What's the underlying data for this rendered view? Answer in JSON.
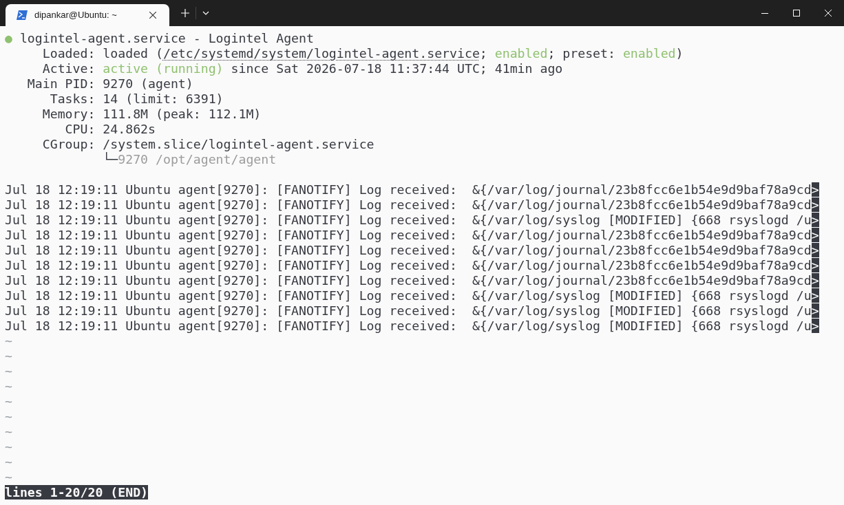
{
  "tabs": [
    {
      "title": "dipankar@Ubuntu: ~",
      "selected": true
    }
  ],
  "terminal": {
    "blocks": [
      {
        "lines": [
          {
            "segments": [
              {
                "text": "●",
                "kind": "green"
              },
              {
                "text": " logintel-agent.service - Logintel Agent",
                "kind": "normal"
              }
            ]
          },
          {
            "segments": [
              {
                "text": "     Loaded: loaded (",
                "kind": "normal"
              },
              {
                "text": "/etc/systemd/system/logintel-agent.service",
                "kind": "link"
              },
              {
                "text": "; ",
                "kind": "normal"
              },
              {
                "text": "enabled",
                "kind": "green"
              },
              {
                "text": "; preset: ",
                "kind": "normal"
              },
              {
                "text": "enabled",
                "kind": "green"
              },
              {
                "text": ")",
                "kind": "normal"
              }
            ]
          },
          {
            "segments": [
              {
                "text": "     Active: ",
                "kind": "normal"
              },
              {
                "text": "active (running)",
                "kind": "green"
              },
              {
                "text": " since Sat 2026-07-18 11:37:44 UTC; 41min ago",
                "kind": "normal"
              }
            ]
          },
          {
            "segments": [
              {
                "text": "   Main PID: 9270 (agent)",
                "kind": "normal"
              }
            ]
          },
          {
            "segments": [
              {
                "text": "      Tasks: 14 (limit: 6391)",
                "kind": "normal"
              }
            ]
          },
          {
            "segments": [
              {
                "text": "     Memory: 111.8M (peak: 112.1M)",
                "kind": "normal"
              }
            ]
          },
          {
            "segments": [
              {
                "text": "        CPU: 24.862s",
                "kind": "normal"
              }
            ]
          },
          {
            "segments": [
              {
                "text": "     CGroup: /system.slice/logintel-agent.service",
                "kind": "normal"
              }
            ]
          },
          {
            "segments": [
              {
                "text": "             └─",
                "kind": "normal"
              },
              {
                "text": "9270 /opt/agent/agent",
                "kind": "dim"
              }
            ]
          }
        ]
      },
      {
        "lines": [
          {
            "segments": [
              {
                "text": "Jul 18 12:19:11 Ubuntu agent[9270]: [FANOTIFY] Log received:  &{/var/log/journal/23b8fcc6e1b54e9d9baf78a9cd",
                "kind": "normal"
              },
              {
                "text": ">",
                "kind": "reverse"
              }
            ]
          },
          {
            "segments": [
              {
                "text": "Jul 18 12:19:11 Ubuntu agent[9270]: [FANOTIFY] Log received:  &{/var/log/journal/23b8fcc6e1b54e9d9baf78a9cd",
                "kind": "normal"
              },
              {
                "text": ">",
                "kind": "reverse"
              }
            ]
          },
          {
            "segments": [
              {
                "text": "Jul 18 12:19:11 Ubuntu agent[9270]: [FANOTIFY] Log received:  &{/var/log/syslog [MODIFIED] {668 rsyslogd /u",
                "kind": "normal"
              },
              {
                "text": ">",
                "kind": "reverse"
              }
            ]
          },
          {
            "segments": [
              {
                "text": "Jul 18 12:19:11 Ubuntu agent[9270]: [FANOTIFY] Log received:  &{/var/log/journal/23b8fcc6e1b54e9d9baf78a9cd",
                "kind": "normal"
              },
              {
                "text": ">",
                "kind": "reverse"
              }
            ]
          },
          {
            "segments": [
              {
                "text": "Jul 18 12:19:11 Ubuntu agent[9270]: [FANOTIFY] Log received:  &{/var/log/journal/23b8fcc6e1b54e9d9baf78a9cd",
                "kind": "normal"
              },
              {
                "text": ">",
                "kind": "reverse"
              }
            ]
          },
          {
            "segments": [
              {
                "text": "Jul 18 12:19:11 Ubuntu agent[9270]: [FANOTIFY] Log received:  &{/var/log/journal/23b8fcc6e1b54e9d9baf78a9cd",
                "kind": "normal"
              },
              {
                "text": ">",
                "kind": "reverse"
              }
            ]
          },
          {
            "segments": [
              {
                "text": "Jul 18 12:19:11 Ubuntu agent[9270]: [FANOTIFY] Log received:  &{/var/log/journal/23b8fcc6e1b54e9d9baf78a9cd",
                "kind": "normal"
              },
              {
                "text": ">",
                "kind": "reverse"
              }
            ]
          },
          {
            "segments": [
              {
                "text": "Jul 18 12:19:11 Ubuntu agent[9270]: [FANOTIFY] Log received:  &{/var/log/syslog [MODIFIED] {668 rsyslogd /u",
                "kind": "normal"
              },
              {
                "text": ">",
                "kind": "reverse"
              }
            ]
          },
          {
            "segments": [
              {
                "text": "Jul 18 12:19:11 Ubuntu agent[9270]: [FANOTIFY] Log received:  &{/var/log/syslog [MODIFIED] {668 rsyslogd /u",
                "kind": "normal"
              },
              {
                "text": ">",
                "kind": "reverse"
              }
            ]
          },
          {
            "segments": [
              {
                "text": "Jul 18 12:19:11 Ubuntu agent[9270]: [FANOTIFY] Log received:  &{/var/log/syslog [MODIFIED] {668 rsyslogd /u",
                "kind": "normal"
              },
              {
                "text": ">",
                "kind": "reverse"
              }
            ]
          },
          {
            "segments": [
              {
                "text": "~",
                "kind": "tilde"
              }
            ]
          },
          {
            "segments": [
              {
                "text": "~",
                "kind": "tilde"
              }
            ]
          },
          {
            "segments": [
              {
                "text": "~",
                "kind": "tilde"
              }
            ]
          },
          {
            "segments": [
              {
                "text": "~",
                "kind": "tilde"
              }
            ]
          },
          {
            "segments": [
              {
                "text": "~",
                "kind": "tilde"
              }
            ]
          },
          {
            "segments": [
              {
                "text": "~",
                "kind": "tilde"
              }
            ]
          },
          {
            "segments": [
              {
                "text": "~",
                "kind": "tilde"
              }
            ]
          },
          {
            "segments": [
              {
                "text": "~",
                "kind": "tilde"
              }
            ]
          },
          {
            "segments": [
              {
                "text": "~",
                "kind": "tilde"
              }
            ]
          },
          {
            "segments": [
              {
                "text": "~",
                "kind": "tilde"
              }
            ]
          }
        ]
      }
    ],
    "status_line": "lines 1-20/20 (END)"
  }
}
